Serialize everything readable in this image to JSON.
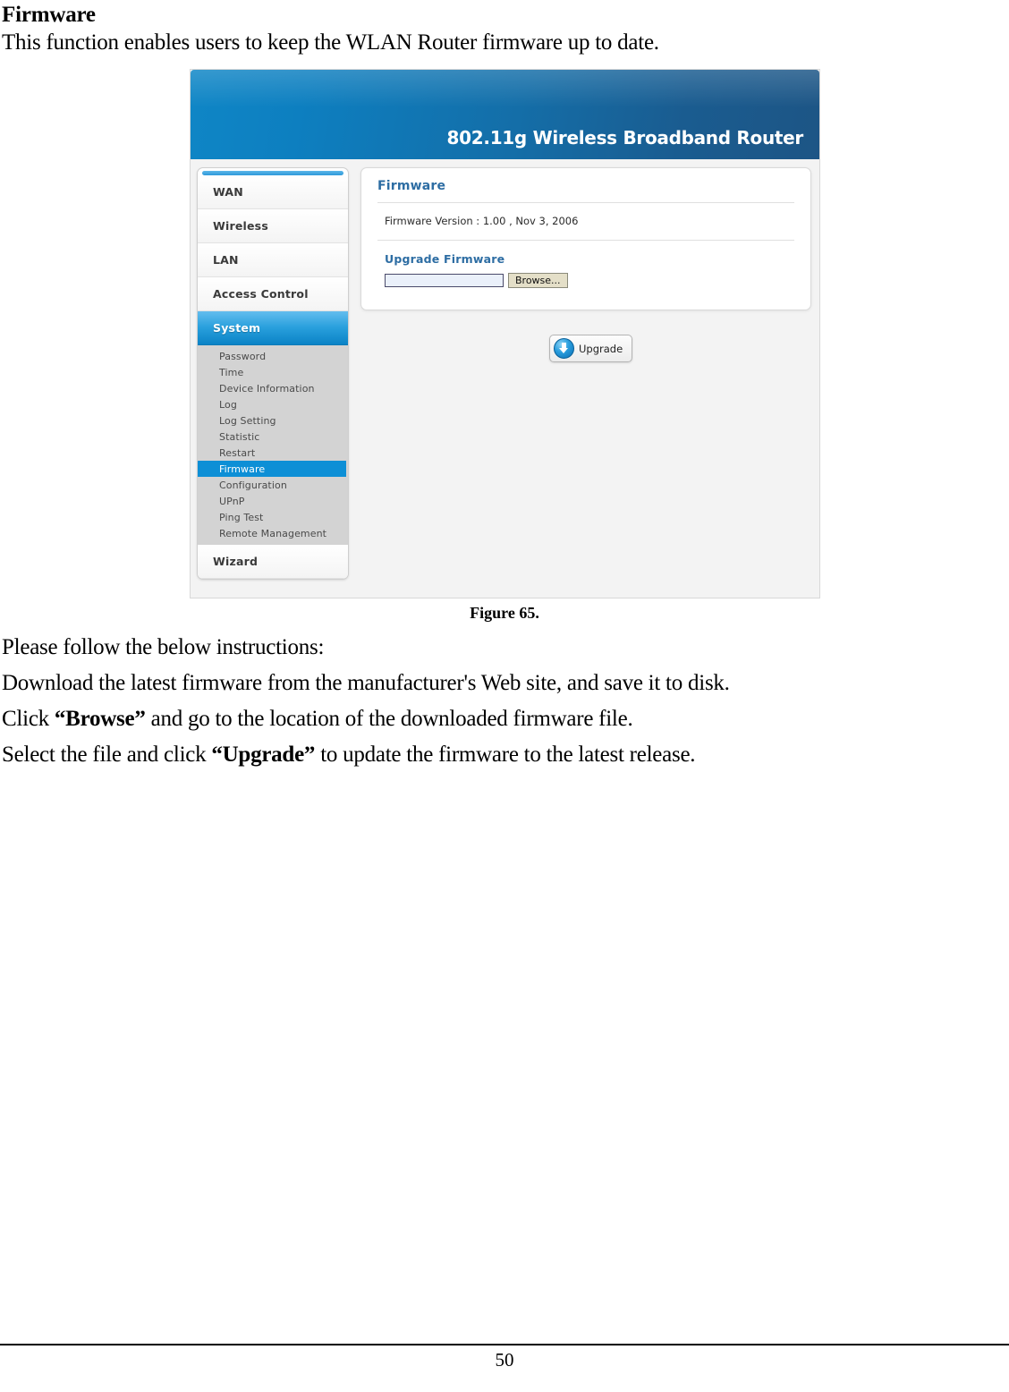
{
  "document": {
    "heading": "Firmware",
    "intro": "This function enables users to keep the WLAN Router firmware up to date.",
    "figure_caption": "Figure 65.",
    "instructions": {
      "lead": "Please follow the below instructions:",
      "step1": "Download the latest firmware from the manufacturer's Web site, and save it to disk.",
      "step2_pre": "Click ",
      "step2_bold": "“Browse”",
      "step2_post": " and go to the location of the downloaded firmware file.",
      "step3_pre": "Select the file and click ",
      "step3_bold": "“Upgrade”",
      "step3_post": " to update the firmware to the latest release."
    },
    "page_number": "50"
  },
  "router_ui": {
    "banner_title": "802.11g Wireless Broadband Router",
    "sidebar": {
      "main_items": [
        {
          "label": "WAN",
          "active": false
        },
        {
          "label": "Wireless",
          "active": false
        },
        {
          "label": "LAN",
          "active": false
        },
        {
          "label": "Access Control",
          "active": false
        },
        {
          "label": "System",
          "active": true
        }
      ],
      "sub_items": [
        {
          "label": "Password",
          "active": false
        },
        {
          "label": "Time",
          "active": false
        },
        {
          "label": "Device Information",
          "active": false
        },
        {
          "label": "Log",
          "active": false
        },
        {
          "label": "Log Setting",
          "active": false
        },
        {
          "label": "Statistic",
          "active": false
        },
        {
          "label": "Restart",
          "active": false
        },
        {
          "label": "Firmware",
          "active": true
        },
        {
          "label": "Configuration",
          "active": false
        },
        {
          "label": "UPnP",
          "active": false
        },
        {
          "label": "Ping Test",
          "active": false
        },
        {
          "label": "Remote Management",
          "active": false
        }
      ],
      "wizard_label": "Wizard"
    },
    "panel": {
      "title": "Firmware",
      "version_text": "Firmware Version : 1.00 , Nov 3, 2006",
      "upgrade_section_label": "Upgrade Firmware",
      "file_field_value": "",
      "browse_label": "Browse...",
      "upgrade_button_label": "Upgrade"
    },
    "colors": {
      "banner_left": "#0f86c6",
      "banner_right": "#1d5585",
      "active_main": "#0b83c6",
      "active_sub": "#0d8fd6",
      "panel_heading": "#2d6da3",
      "submenu_bg": "#d3d3d3"
    }
  }
}
